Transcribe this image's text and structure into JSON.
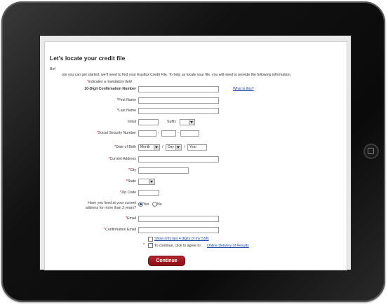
{
  "form": {
    "title": "Let's locate your credit file",
    "intro_prefix": "Bef",
    "intro": "ore you can get started, we'll need to find your Equifax Credit File.  To help us locate your file, you will need to provide the following information.",
    "mandatory_note": "indicates a mandatory field",
    "star": "*",
    "confirmation_label": "10-Digit Confirmation Number",
    "what_is_this": "What is this?",
    "first_name_label": "First Name",
    "last_name_label": "Last Name",
    "initial_label": "Initial",
    "suffix_label": "Suffix",
    "ssn_label": "Social Security Number",
    "ssn_sep": "-",
    "dob_label": "Date of Birth",
    "dob_month": "Month",
    "dob_day": "Day",
    "dob_year": "Year",
    "dob_sep": "/",
    "address_label": "Current Address",
    "city_label": "City",
    "state_label": "State",
    "zip_label": "Zip Code",
    "lived_label_1": "Have you lived at your current",
    "lived_label_2": "address for more than 2 years?",
    "yes": "Yes",
    "no": "No",
    "email_label": "Email",
    "confirm_email_label": "Confirmation Email",
    "show_ssn": "Show only last 4 digits of my SSN",
    "agree_text": "To continue, click to agree to",
    "agree_link": "Online Delivery of Results",
    "continue_button": "Continue"
  },
  "colors": {
    "button": "#9e1a22",
    "link": "#1a44aa",
    "required": "#cc0000"
  }
}
